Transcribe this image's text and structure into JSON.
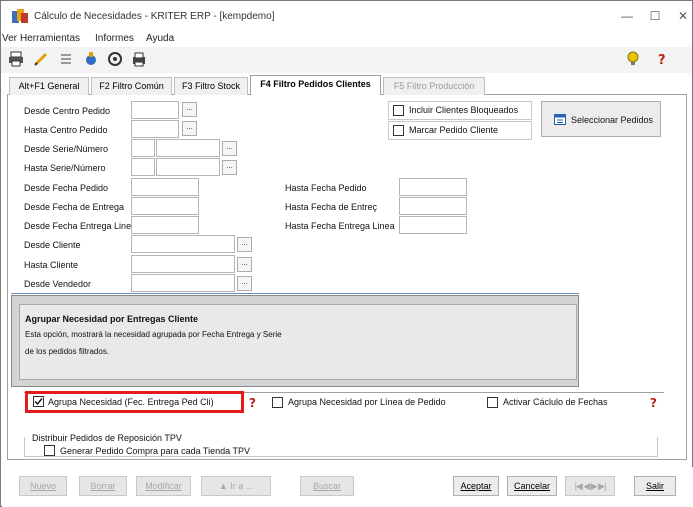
{
  "window": {
    "title": "Cálculo de Necesidades - KRITER ERP - [kempdemo]",
    "controls": [
      "—",
      "☐",
      "✕"
    ]
  },
  "menu": [
    "Ver",
    "Herramientas",
    "Informes",
    "Ayuda"
  ],
  "toolbar_icons": [
    "print-icon",
    "pencil-icon",
    "list-icon",
    "settings-icon",
    "preview-icon",
    "printer-icon"
  ],
  "tabs": [
    {
      "label": "Alt+F1 General",
      "state": "normal"
    },
    {
      "label": "F2 Filtro Común",
      "state": "normal"
    },
    {
      "label": "F3 Filtro Stock",
      "state": "normal"
    },
    {
      "label": "F4 Filtro Pedidos Clientes",
      "state": "active"
    },
    {
      "label": "F5 Filtro Producción",
      "state": "disabled"
    }
  ],
  "fields_left": [
    "Desde Centro Pedido",
    "Hasta Centro Pedido",
    "Desde Serie/Número",
    "Hasta Serie/Número",
    "Desde Fecha Pedido",
    "Desde Fecha de Entrega",
    "Desde Fecha Entrega Line",
    "Desde Cliente",
    "Hasta Cliente",
    "Desde Vendedor"
  ],
  "fields_right": [
    "Hasta Fecha Pedido",
    "Hasta Fecha de Entreç",
    "Hasta Fecha Entrega Linea"
  ],
  "checkboxes_top": [
    {
      "label": "Incluir Clientes Bloqueados",
      "checked": false
    },
    {
      "label": "Marcar Pedido Cliente",
      "checked": false
    }
  ],
  "select_orders_button": "Seleccionar Pedidos",
  "help": {
    "title": "Agrupar Necesidad por Entregas Cliente",
    "line1": "Esta opción, mostrará la necesidad agrupada por Fecha Entrega y Serie",
    "line2": "de los pedidos filtrados."
  },
  "options": [
    {
      "label": "Agrupa Necesidad (Fec. Entrega Ped Cli)",
      "checked": true
    },
    {
      "label": "Agrupa Necesidad por Línea de Pedido",
      "checked": false
    },
    {
      "label": "Activar Cáclulo de Fechas",
      "checked": false
    }
  ],
  "tpv_group": {
    "title": "Distribuir Pedidos de Reposición TPV",
    "checkbox_label": "Generar Pedido Compra para cada Tienda TPV",
    "checked": false
  },
  "bottom_buttons": {
    "nuevo": "Nuevo",
    "borrar": "Borrar",
    "modificar": "Modificar",
    "ir": "▲ Ir a ...",
    "buscar": "Buscar",
    "aceptar": "Aceptar",
    "cancelar": "Cancelar",
    "nav": "|◀ ◀ ▶ ▶|",
    "salir": "Salir"
  },
  "colors": {
    "highlight_box": "#e31b1b",
    "help_icon": "#c0201a",
    "bulb_icon": "#e8c400"
  }
}
